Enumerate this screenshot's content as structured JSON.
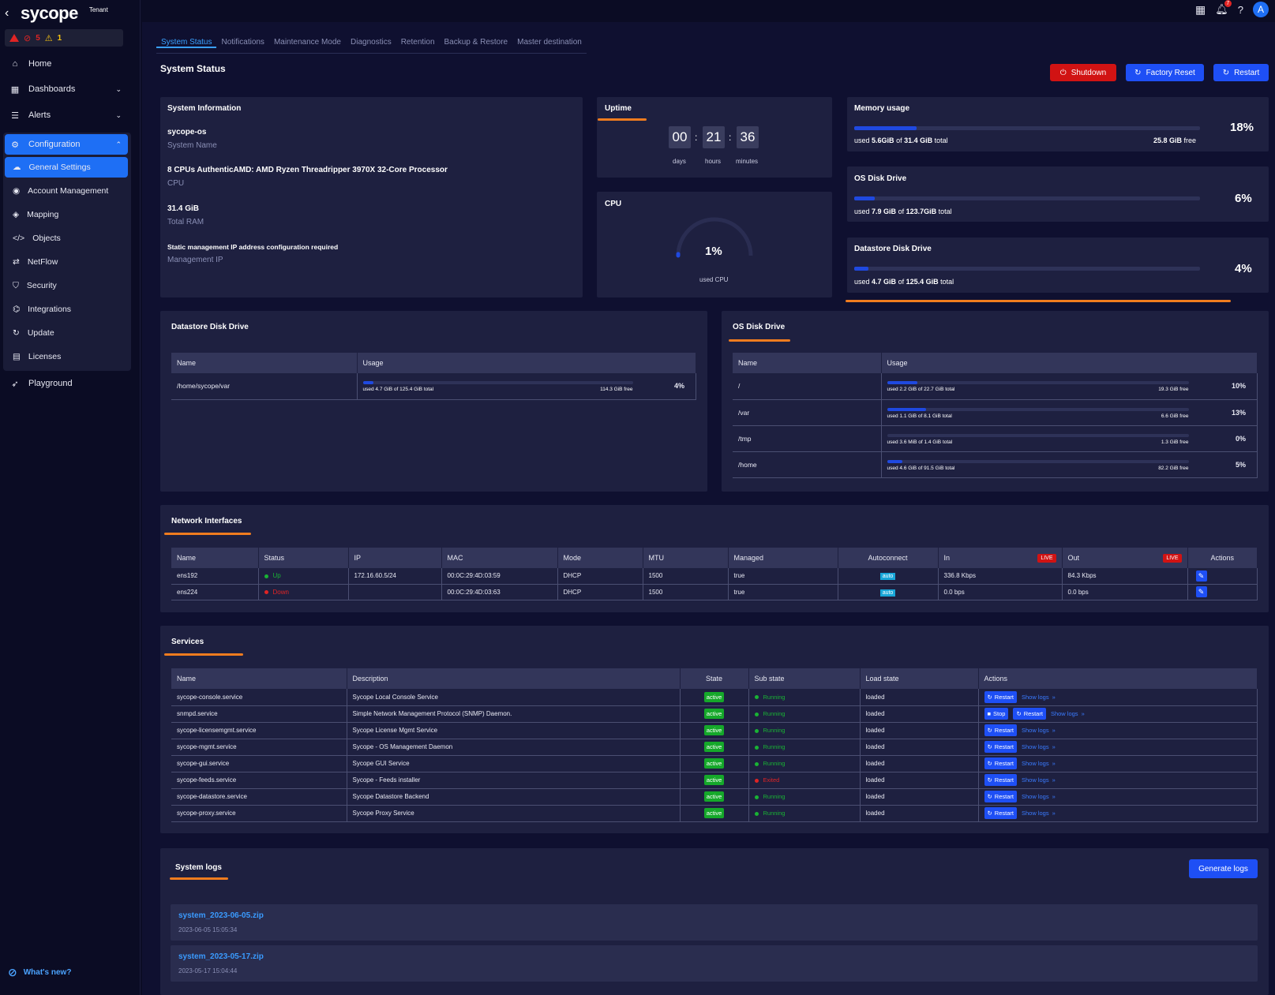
{
  "brand": {
    "logo": "sycope",
    "tenant": "Tenant",
    "back": "‹"
  },
  "alerts": {
    "critical": "5",
    "warning": "1"
  },
  "colors": {
    "accent": "#1e6ff5",
    "danger": "#d11313",
    "orange": "#f07c1f",
    "success": "#15a82a"
  },
  "nav": {
    "home": "Home",
    "dashboards": "Dashboards",
    "alerts": "Alerts",
    "configuration": "Configuration",
    "sub": [
      "General Settings",
      "Account Management",
      "Mapping",
      "Objects",
      "NetFlow",
      "Security",
      "Integrations",
      "Update",
      "Licenses"
    ],
    "playground": "Playground",
    "whats_new": "What's new?"
  },
  "topbar": {
    "avatar": "A",
    "notif_count": "7"
  },
  "tabs": [
    "System Status",
    "Notifications",
    "Maintenance Mode",
    "Diagnostics",
    "Retention",
    "Backup & Restore",
    "Master destination"
  ],
  "page_title": "System Status",
  "buttons": {
    "shutdown": "Shutdown",
    "factory_reset": "Factory Reset",
    "restart": "Restart",
    "generate_logs": "Generate logs"
  },
  "system_info": {
    "title": "System Information",
    "system_name": "sycope-os",
    "system_name_label": "System Name",
    "cpu": "8 CPUs AuthenticAMD: AMD Ryzen Threadripper 3970X 32-Core Processor",
    "cpu_label": "CPU",
    "ram": "31.4 GiB",
    "ram_label": "Total RAM",
    "mgmt_ip": "Static management IP address configuration required",
    "mgmt_ip_label": "Management IP"
  },
  "uptime": {
    "title": "Uptime",
    "days": "00",
    "hours": "21",
    "minutes": "36",
    "days_label": "days",
    "hours_label": "hours",
    "minutes_label": "minutes"
  },
  "cpu": {
    "title": "CPU",
    "value": "1%",
    "label": "used CPU",
    "fraction": 0.01
  },
  "memory": {
    "title": "Memory usage",
    "used_prefix": "used",
    "used": "5.6GiB",
    "of": "of",
    "total": "31.4 GiB",
    "total_suffix": "total",
    "free": "25.8 GiB",
    "free_suffix": "free",
    "pct": "18%",
    "fraction": 0.18
  },
  "os_disk_summary": {
    "title": "OS Disk Drive",
    "used": "7.9 GiB",
    "total": "123.7GiB",
    "pct": "6%",
    "fraction": 0.06
  },
  "datastore_summary": {
    "title": "Datastore Disk Drive",
    "used": "4.7 GiB",
    "total": "125.4 GiB",
    "pct": "4%",
    "fraction": 0.04
  },
  "datastore_table": {
    "title": "Datastore Disk Drive",
    "headers": [
      "Name",
      "Usage"
    ],
    "rows": [
      {
        "name": "/home/sycope/var",
        "used": "used 4.7 GiB of 125.4 GiB total",
        "free": "114.3 GiB free",
        "pct": "4%",
        "fraction": 0.04
      }
    ]
  },
  "os_disk_table": {
    "title": "OS Disk Drive",
    "headers": [
      "Name",
      "Usage"
    ],
    "rows": [
      {
        "name": "/",
        "used": "used 2.2 GiB of 22.7 GiB total",
        "free": "19.3 GiB free",
        "pct": "10%",
        "fraction": 0.1
      },
      {
        "name": "/var",
        "used": "used 1.1 GiB of 8.1 GiB total",
        "free": "6.6 GiB free",
        "pct": "13%",
        "fraction": 0.13
      },
      {
        "name": "/tmp",
        "used": "used 3.6 MiB of 1.4 GiB total",
        "free": "1.3 GiB free",
        "pct": "0%",
        "fraction": 0.0
      },
      {
        "name": "/home",
        "used": "used 4.6 GiB of 91.5 GiB total",
        "free": "82.2 GiB free",
        "pct": "5%",
        "fraction": 0.05
      }
    ]
  },
  "network": {
    "title": "Network Interfaces",
    "headers": [
      "Name",
      "Status",
      "IP",
      "MAC",
      "Mode",
      "MTU",
      "Managed",
      "Autoconnect",
      "In",
      "Out",
      "Actions"
    ],
    "live": "LIVE",
    "rows": [
      {
        "name": "ens192",
        "status": "Up",
        "ip": "172.16.60.5/24",
        "mac": "00:0C:29:4D:03:59",
        "mode": "DHCP",
        "mtu": "1500",
        "managed": "true",
        "autoconnect": "auto",
        "in": "336.8 Kbps",
        "out": "84.3 Kbps"
      },
      {
        "name": "ens224",
        "status": "Down",
        "ip": "",
        "mac": "00:0C:29:4D:03:63",
        "mode": "DHCP",
        "mtu": "1500",
        "managed": "true",
        "autoconnect": "auto",
        "in": "0.0 bps",
        "out": "0.0 bps"
      }
    ]
  },
  "services": {
    "title": "Services",
    "headers": [
      "Name",
      "Description",
      "State",
      "Sub state",
      "Load state",
      "Actions"
    ],
    "show_logs": "Show logs",
    "restart": "Restart",
    "stop": "Stop",
    "rows": [
      {
        "name": "sycope-console.service",
        "desc": "Sycope Local Console Service",
        "state": "active",
        "sub": "Running",
        "load": "loaded",
        "stop": false
      },
      {
        "name": "snmpd.service",
        "desc": "Simple Network Management Protocol (SNMP) Daemon.",
        "state": "active",
        "sub": "Running",
        "load": "loaded",
        "stop": true
      },
      {
        "name": "sycope-licensemgmt.service",
        "desc": "Sycope License Mgmt Service",
        "state": "active",
        "sub": "Running",
        "load": "loaded",
        "stop": false
      },
      {
        "name": "sycope-mgmt.service",
        "desc": "Sycope - OS Management Daemon",
        "state": "active",
        "sub": "Running",
        "load": "loaded",
        "stop": false
      },
      {
        "name": "sycope-gui.service",
        "desc": "Sycope GUI Service",
        "state": "active",
        "sub": "Running",
        "load": "loaded",
        "stop": false
      },
      {
        "name": "sycope-feeds.service",
        "desc": "Sycope - Feeds installer",
        "state": "active",
        "sub": "Exited",
        "load": "loaded",
        "stop": false
      },
      {
        "name": "sycope-datastore.service",
        "desc": "Sycope Datastore Backend",
        "state": "active",
        "sub": "Running",
        "load": "loaded",
        "stop": false
      },
      {
        "name": "sycope-proxy.service",
        "desc": "Sycope Proxy Service",
        "state": "active",
        "sub": "Running",
        "load": "loaded",
        "stop": false
      }
    ]
  },
  "logs": {
    "title": "System logs",
    "items": [
      {
        "name": "system_2023-06-05.zip",
        "date": "2023-06-05 15:05:34"
      },
      {
        "name": "system_2023-05-17.zip",
        "date": "2023-05-17 15:04:44"
      }
    ]
  }
}
